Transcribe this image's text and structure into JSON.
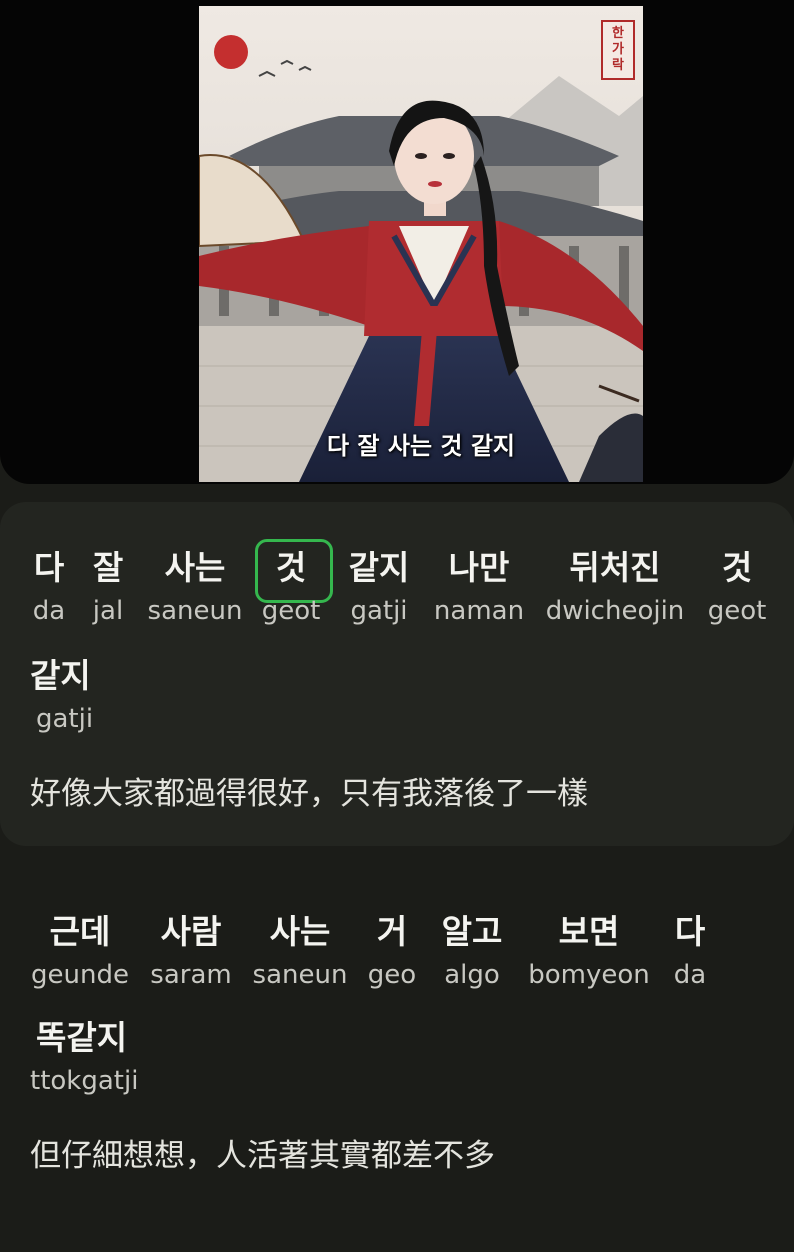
{
  "video": {
    "subtitle": "다 잘 사는 것 같지",
    "seal_text": "한가락"
  },
  "lyrics": [
    {
      "words": [
        {
          "ko": "다",
          "rom": "da"
        },
        {
          "ko": "잘",
          "rom": "jal"
        },
        {
          "ko": "사는",
          "rom": "saneun"
        },
        {
          "ko": "것",
          "rom": "geot",
          "highlighted": true
        },
        {
          "ko": "같지",
          "rom": "gatji"
        },
        {
          "ko": "나만",
          "rom": "naman"
        },
        {
          "ko": "뒤처진",
          "rom": "dwicheojin"
        },
        {
          "ko": "것",
          "rom": "geot"
        },
        {
          "ko": "같지",
          "rom": "gatji"
        }
      ],
      "translation": "好像大家都過得很好，只有我落後了一樣",
      "active": true
    },
    {
      "words": [
        {
          "ko": "근데",
          "rom": "geunde"
        },
        {
          "ko": "사람",
          "rom": "saram"
        },
        {
          "ko": "사는",
          "rom": "saneun"
        },
        {
          "ko": "거",
          "rom": "geo"
        },
        {
          "ko": "알고",
          "rom": "algo"
        },
        {
          "ko": "보면",
          "rom": "bomyeon"
        },
        {
          "ko": "다",
          "rom": "da"
        },
        {
          "ko": "똑같지",
          "rom": "ttokgatji"
        }
      ],
      "translation": "但仔細想想，人活著其實都差不多",
      "active": false
    }
  ],
  "colors": {
    "highlight": "#35b74e",
    "active_card": "#232520",
    "background": "#1b1c18"
  }
}
